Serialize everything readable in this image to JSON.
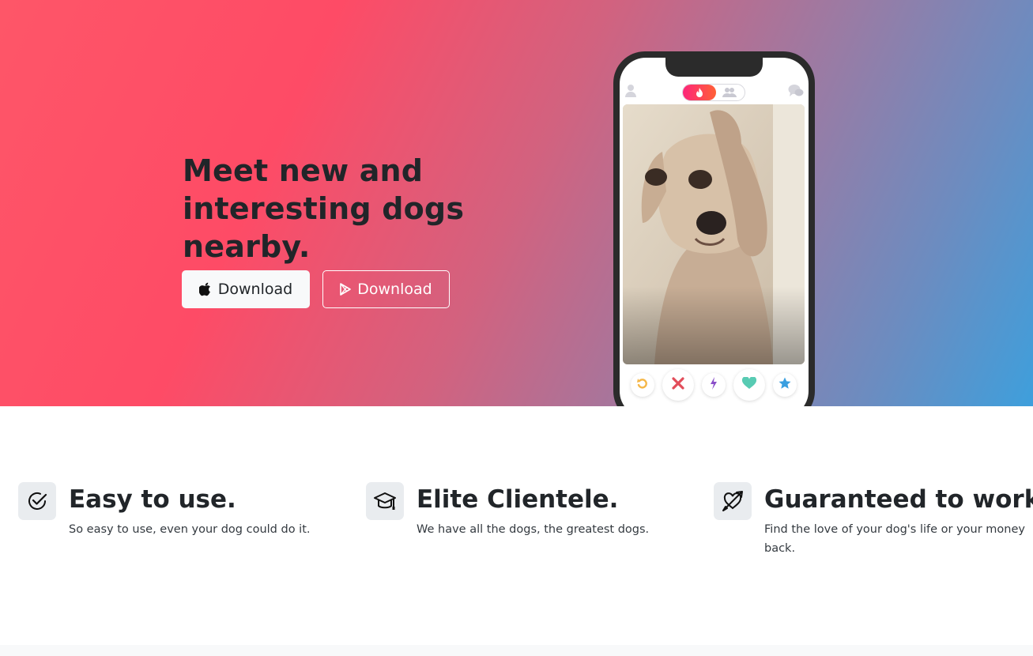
{
  "hero": {
    "title": "Meet new and interesting dogs nearby.",
    "buttons": {
      "apple_label": "Download",
      "apple_icon": "apple-icon",
      "play_label": "Download",
      "play_icon": "google-play-icon"
    },
    "gradient": [
      "#fe5668",
      "#fe4b66",
      "#d2627f",
      "#9a7ba4",
      "#6c8cc0",
      "#3e9fdc"
    ]
  },
  "phone": {
    "top_bar_icons": [
      "profile-icon",
      "flame-icon",
      "group-icon",
      "chat-icon"
    ],
    "action_icons": [
      "rewind-icon",
      "nope-icon",
      "boost-icon",
      "like-icon",
      "super-like-icon"
    ],
    "colors": {
      "rewind": "#f5b748",
      "nope": "#e24d5a",
      "boost": "#8a4ec9",
      "like": "#58cbb3",
      "super_like": "#3a9fe0"
    }
  },
  "features": [
    {
      "icon": "check-circle-icon",
      "title": "Easy to use.",
      "text": "So easy to use, even your dog could do it."
    },
    {
      "icon": "graduation-cap-icon",
      "title": "Elite Clientele.",
      "text": "We have all the dogs, the greatest dogs."
    },
    {
      "icon": "heart-arrow-icon",
      "title": "Guaranteed to work.",
      "text": "Find the love of your dog's life or your money back."
    }
  ]
}
